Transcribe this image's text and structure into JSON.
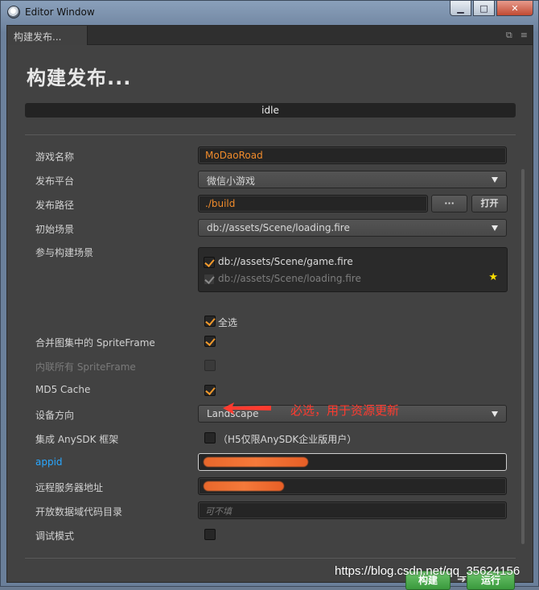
{
  "window": {
    "title": "Editor Window",
    "controls": {
      "minimize": "▁",
      "maximize": "□",
      "close": "✕"
    }
  },
  "tab": {
    "label": "构建发布...",
    "restore_icon": "⧉",
    "menu_icon": "≡"
  },
  "page": {
    "title": "构建发布...",
    "status": "idle"
  },
  "fields": {
    "game_name": {
      "label": "游戏名称",
      "value": "MoDaoRoad"
    },
    "platform": {
      "label": "发布平台",
      "value": "微信小游戏"
    },
    "build_path": {
      "label": "发布路径",
      "value": "./build",
      "browse_label": "···",
      "open_label": "打开"
    },
    "start_scene": {
      "label": "初始场景",
      "value": "db://assets/Scene/loading.fire"
    },
    "included_scenes": {
      "label": "参与构建场景",
      "items": [
        {
          "path": "db://assets/Scene/game.fire",
          "checked": true
        },
        {
          "path": "db://assets/Scene/loading.fire",
          "checked": true,
          "start": true
        }
      ],
      "select_all_label": "全选"
    },
    "merge_sprite": {
      "label": "合并图集中的 SpriteFrame",
      "checked": true
    },
    "inline_sprite": {
      "label": "内联所有 SpriteFrame",
      "checked": false
    },
    "md5_cache": {
      "label": "MD5 Cache",
      "checked": true
    },
    "orientation": {
      "label": "设备方向",
      "value": "Landscape"
    },
    "anysdk": {
      "label": "集成 AnySDK 框架",
      "hint": "（H5仅限AnySDK企业版用户）",
      "checked": false
    },
    "appid": {
      "label": "appid"
    },
    "remote_server": {
      "label": "远程服务器地址"
    },
    "open_data_dir": {
      "label": "开放数据域代码目录",
      "placeholder": "可不填"
    },
    "debug_mode": {
      "label": "调试模式",
      "checked": false
    }
  },
  "annotation": {
    "text": "必选，用于资源更新",
    "color": "#ff3b2f"
  },
  "actions": {
    "build_label": "构建",
    "run_label": "运行",
    "arrow": "➜"
  },
  "watermark": "https://blog.csdn.net/qq_35624156",
  "colors": {
    "accent": "#f08b2b",
    "link": "#29a8ff",
    "button_green": "#4aad4b",
    "star": "#ffe000"
  }
}
